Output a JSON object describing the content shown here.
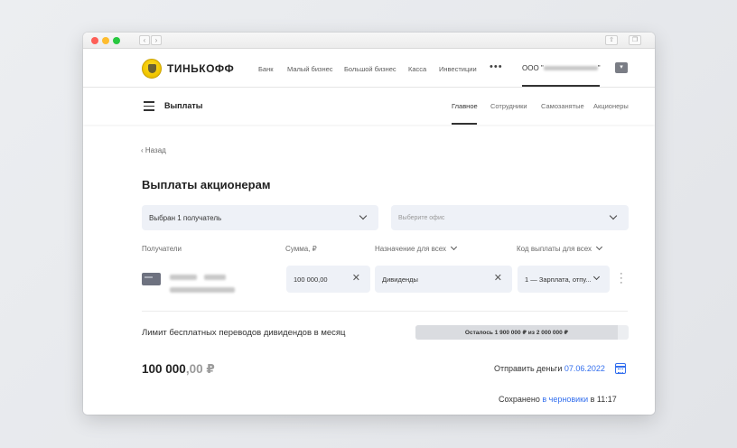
{
  "header": {
    "brand": "ТИНЬКОФФ",
    "nav": [
      "Банк",
      "Малый бизнес",
      "Большой бизнес",
      "Касса",
      "Инвестиции"
    ],
    "more": "•••",
    "company_prefix": "ООО \"",
    "company_suffix": "\""
  },
  "subheader": {
    "title": "Выплаты",
    "tabs": [
      "Главное",
      "Сотрудники",
      "Самозанятые",
      "Акционеры"
    ],
    "active_tab": "Главное"
  },
  "page": {
    "back": "Назад",
    "title": "Выплаты акционерам",
    "recipient_select": "Выбран 1 получатель",
    "office_placeholder": "Выберите офис",
    "columns": [
      "Получатели",
      "Сумма, ₽",
      "Назначение для всех",
      "Код выплаты для всех"
    ],
    "row": {
      "amount": "100 000,00",
      "purpose": "Дивиденды",
      "code": "1 — Зарплата, отпу..."
    },
    "limit_label": "Лимит бесплатных переводов дивидендов в месяц",
    "limit_text": "Осталось 1 900 000 ₽ из 2 000 000 ₽",
    "limit_remaining_fraction": 0.95,
    "total_int": "100 000",
    "total_dec": ",00",
    "total_currency": " ₽",
    "send_label": "Отправить деньги",
    "send_date": "07.06.2022",
    "saved_prefix": "Сохранено",
    "saved_link": "в черновики",
    "saved_time": "в 11:17"
  },
  "colors": {
    "accent": "#336fee",
    "brand_yellow": "#ffdd2d",
    "field_bg": "#eef1f7"
  }
}
